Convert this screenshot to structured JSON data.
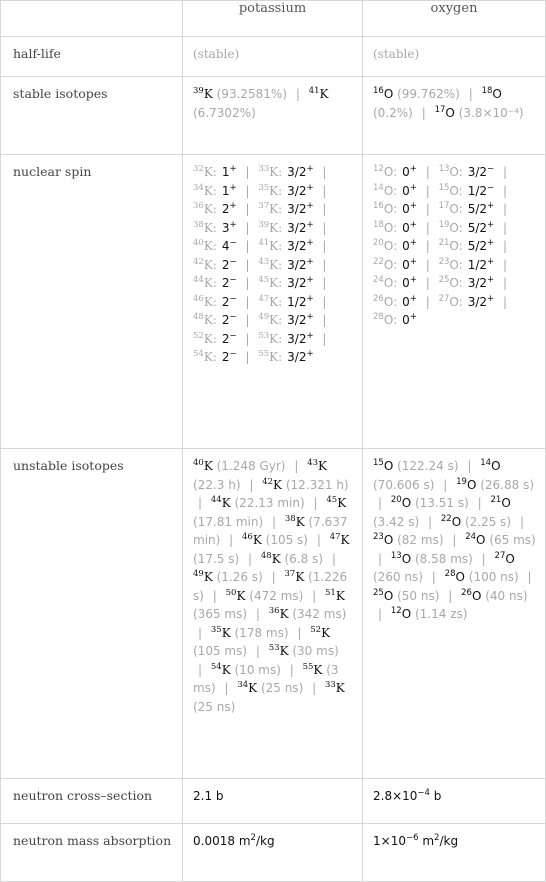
{
  "columns": [
    "",
    "potassium",
    "oxygen"
  ],
  "rows": {
    "half_life": {
      "label": "half-life",
      "potassium": "(stable)",
      "oxygen": "(stable)"
    },
    "stable_isotopes": {
      "label": "stable isotopes",
      "potassium": [
        {
          "mass": "39",
          "symbol": "K",
          "value": "(93.2581%)"
        },
        {
          "mass": "41",
          "symbol": "K",
          "value": "(6.7302%)"
        }
      ],
      "oxygen": [
        {
          "mass": "16",
          "symbol": "O",
          "value": "(99.762%)"
        },
        {
          "mass": "18",
          "symbol": "O",
          "value": "(0.2%)"
        },
        {
          "mass": "17",
          "symbol": "O",
          "value": "(3.8×10⁻⁴)"
        }
      ]
    },
    "nuclear_spin": {
      "label": "nuclear spin",
      "potassium": [
        {
          "mass": "32",
          "symbol": "K",
          "spin": "1",
          "parity": "+"
        },
        {
          "mass": "33",
          "symbol": "K",
          "spin": "3/2",
          "parity": "+"
        },
        {
          "mass": "34",
          "symbol": "K",
          "spin": "1",
          "parity": "+"
        },
        {
          "mass": "35",
          "symbol": "K",
          "spin": "3/2",
          "parity": "+"
        },
        {
          "mass": "36",
          "symbol": "K",
          "spin": "2",
          "parity": "+"
        },
        {
          "mass": "37",
          "symbol": "K",
          "spin": "3/2",
          "parity": "+"
        },
        {
          "mass": "38",
          "symbol": "K",
          "spin": "3",
          "parity": "+"
        },
        {
          "mass": "39",
          "symbol": "K",
          "spin": "3/2",
          "parity": "+"
        },
        {
          "mass": "40",
          "symbol": "K",
          "spin": "4",
          "parity": "−"
        },
        {
          "mass": "41",
          "symbol": "K",
          "spin": "3/2",
          "parity": "+"
        },
        {
          "mass": "42",
          "symbol": "K",
          "spin": "2",
          "parity": "−"
        },
        {
          "mass": "43",
          "symbol": "K",
          "spin": "3/2",
          "parity": "+"
        },
        {
          "mass": "44",
          "symbol": "K",
          "spin": "2",
          "parity": "−"
        },
        {
          "mass": "45",
          "symbol": "K",
          "spin": "3/2",
          "parity": "+"
        },
        {
          "mass": "46",
          "symbol": "K",
          "spin": "2",
          "parity": "−"
        },
        {
          "mass": "47",
          "symbol": "K",
          "spin": "1/2",
          "parity": "+"
        },
        {
          "mass": "48",
          "symbol": "K",
          "spin": "2",
          "parity": "−"
        },
        {
          "mass": "49",
          "symbol": "K",
          "spin": "3/2",
          "parity": "+"
        },
        {
          "mass": "52",
          "symbol": "K",
          "spin": "2",
          "parity": "−"
        },
        {
          "mass": "53",
          "symbol": "K",
          "spin": "3/2",
          "parity": "+"
        },
        {
          "mass": "54",
          "symbol": "K",
          "spin": "2",
          "parity": "−"
        },
        {
          "mass": "55",
          "symbol": "K",
          "spin": "3/2",
          "parity": "+"
        }
      ],
      "oxygen": [
        {
          "mass": "12",
          "symbol": "O",
          "spin": "0",
          "parity": "+"
        },
        {
          "mass": "13",
          "symbol": "O",
          "spin": "3/2",
          "parity": "−"
        },
        {
          "mass": "14",
          "symbol": "O",
          "spin": "0",
          "parity": "+"
        },
        {
          "mass": "15",
          "symbol": "O",
          "spin": "1/2",
          "parity": "−"
        },
        {
          "mass": "16",
          "symbol": "O",
          "spin": "0",
          "parity": "+"
        },
        {
          "mass": "17",
          "symbol": "O",
          "spin": "5/2",
          "parity": "+"
        },
        {
          "mass": "18",
          "symbol": "O",
          "spin": "0",
          "parity": "+"
        },
        {
          "mass": "19",
          "symbol": "O",
          "spin": "5/2",
          "parity": "+"
        },
        {
          "mass": "20",
          "symbol": "O",
          "spin": "0",
          "parity": "+"
        },
        {
          "mass": "21",
          "symbol": "O",
          "spin": "5/2",
          "parity": "+"
        },
        {
          "mass": "22",
          "symbol": "O",
          "spin": "0",
          "parity": "+"
        },
        {
          "mass": "23",
          "symbol": "O",
          "spin": "1/2",
          "parity": "+"
        },
        {
          "mass": "24",
          "symbol": "O",
          "spin": "0",
          "parity": "+"
        },
        {
          "mass": "25",
          "symbol": "O",
          "spin": "3/2",
          "parity": "+"
        },
        {
          "mass": "26",
          "symbol": "O",
          "spin": "0",
          "parity": "+"
        },
        {
          "mass": "27",
          "symbol": "O",
          "spin": "3/2",
          "parity": "+"
        },
        {
          "mass": "28",
          "symbol": "O",
          "spin": "0",
          "parity": "+"
        }
      ]
    },
    "unstable_isotopes": {
      "label": "unstable isotopes",
      "potassium": [
        {
          "mass": "40",
          "symbol": "K",
          "value": "(1.248 Gyr)"
        },
        {
          "mass": "43",
          "symbol": "K",
          "value": "(22.3 h)"
        },
        {
          "mass": "42",
          "symbol": "K",
          "value": "(12.321 h)"
        },
        {
          "mass": "44",
          "symbol": "K",
          "value": "(22.13 min)"
        },
        {
          "mass": "45",
          "symbol": "K",
          "value": "(17.81 min)"
        },
        {
          "mass": "38",
          "symbol": "K",
          "value": "(7.637 min)"
        },
        {
          "mass": "46",
          "symbol": "K",
          "value": "(105 s)"
        },
        {
          "mass": "47",
          "symbol": "K",
          "value": "(17.5 s)"
        },
        {
          "mass": "48",
          "symbol": "K",
          "value": "(6.8 s)"
        },
        {
          "mass": "49",
          "symbol": "K",
          "value": "(1.26 s)"
        },
        {
          "mass": "37",
          "symbol": "K",
          "value": "(1.226 s)"
        },
        {
          "mass": "50",
          "symbol": "K",
          "value": "(472 ms)"
        },
        {
          "mass": "51",
          "symbol": "K",
          "value": "(365 ms)"
        },
        {
          "mass": "36",
          "symbol": "K",
          "value": "(342 ms)"
        },
        {
          "mass": "35",
          "symbol": "K",
          "value": "(178 ms)"
        },
        {
          "mass": "52",
          "symbol": "K",
          "value": "(105 ms)"
        },
        {
          "mass": "53",
          "symbol": "K",
          "value": "(30 ms)"
        },
        {
          "mass": "54",
          "symbol": "K",
          "value": "(10 ms)"
        },
        {
          "mass": "55",
          "symbol": "K",
          "value": "(3 ms)"
        },
        {
          "mass": "34",
          "symbol": "K",
          "value": "(25 ns)"
        },
        {
          "mass": "33",
          "symbol": "K",
          "value": "(25 ns)"
        }
      ],
      "oxygen": [
        {
          "mass": "15",
          "symbol": "O",
          "value": "(122.24 s)"
        },
        {
          "mass": "14",
          "symbol": "O",
          "value": "(70.606 s)"
        },
        {
          "mass": "19",
          "symbol": "O",
          "value": "(26.88 s)"
        },
        {
          "mass": "20",
          "symbol": "O",
          "value": "(13.51 s)"
        },
        {
          "mass": "21",
          "symbol": "O",
          "value": "(3.42 s)"
        },
        {
          "mass": "22",
          "symbol": "O",
          "value": "(2.25 s)"
        },
        {
          "mass": "23",
          "symbol": "O",
          "value": "(82 ms)"
        },
        {
          "mass": "24",
          "symbol": "O",
          "value": "(65 ms)"
        },
        {
          "mass": "13",
          "symbol": "O",
          "value": "(8.58 ms)"
        },
        {
          "mass": "27",
          "symbol": "O",
          "value": "(260 ns)"
        },
        {
          "mass": "28",
          "symbol": "O",
          "value": "(100 ns)"
        },
        {
          "mass": "25",
          "symbol": "O",
          "value": "(50 ns)"
        },
        {
          "mass": "26",
          "symbol": "O",
          "value": "(40 ns)"
        },
        {
          "mass": "12",
          "symbol": "O",
          "value": "(1.14 zs)"
        }
      ]
    },
    "neutron_cross_section": {
      "label": "neutron cross–section",
      "potassium": {
        "mantissa": "2.1",
        "exponent": "",
        "unit": "b",
        "unit_exp": ""
      },
      "oxygen": {
        "mantissa": "2.8×10",
        "exponent": "−4",
        "unit": "b",
        "unit_exp": ""
      }
    },
    "neutron_mass_absorption": {
      "label": "neutron mass absorption",
      "potassium": {
        "mantissa": "0.0018",
        "exponent": "",
        "unit": "m",
        "unit_exp": "2",
        "unit_tail": "/kg"
      },
      "oxygen": {
        "mantissa": "1×10",
        "exponent": "−6",
        "unit": "m",
        "unit_exp": "2",
        "unit_tail": "/kg"
      }
    }
  },
  "separator": "|",
  "colors": {
    "border": "#d6d6d6",
    "label_text": "#444444",
    "muted_text": "#a8a8a8",
    "value_text": "#111111"
  }
}
